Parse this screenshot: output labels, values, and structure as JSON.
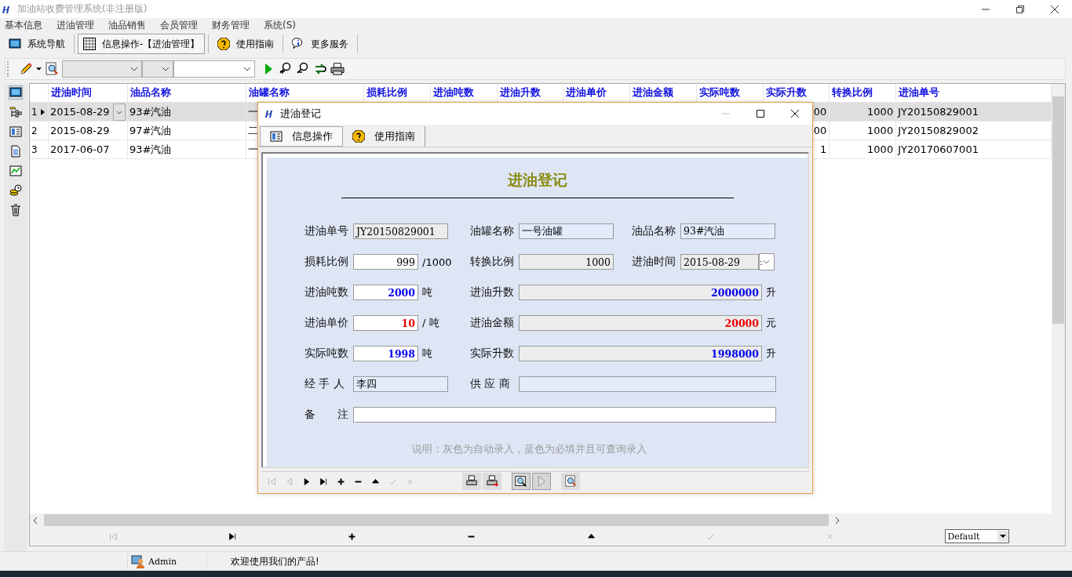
{
  "window": {
    "title": "加油站收费管理系统(非注册版)"
  },
  "menu": [
    "基本信息",
    "进油管理",
    "油品销售",
    "会员管理",
    "财务管理",
    "系统(S)"
  ],
  "toolbar": [
    {
      "label": "系统导航",
      "selected": false
    },
    {
      "label": "信息操作-【进油管理】",
      "selected": true
    },
    {
      "label": "使用指南",
      "selected": false
    },
    {
      "label": "更多服务",
      "selected": false
    }
  ],
  "filter_bar": {
    "combos": [
      {
        "kind": "grey"
      },
      {
        "kind": "grey"
      },
      {
        "kind": "white"
      }
    ]
  },
  "sidebar": {
    "items": [
      {
        "selected": true
      },
      {
        "selected": false
      },
      {
        "selected": false
      },
      {
        "selected": false
      },
      {
        "selected": false
      },
      {
        "selected": false
      },
      {
        "selected": false
      }
    ]
  },
  "table": {
    "columns": [
      {
        "label": "进油时间"
      },
      {
        "label": "油品名称"
      },
      {
        "label": "油罐名称"
      },
      {
        "label": "损耗比例"
      },
      {
        "label": "进油吨数"
      },
      {
        "label": "进油升数"
      },
      {
        "label": "进油单价"
      },
      {
        "label": "进油金额"
      },
      {
        "label": "实际吨数"
      },
      {
        "label": "实际升数"
      },
      {
        "label": "转换比例"
      },
      {
        "label": "进油单号"
      }
    ],
    "rows": [
      {
        "number": "1",
        "selected": true,
        "cells": [
          "2015-08-29",
          "93#汽油",
          "一",
          null,
          null,
          null,
          null,
          null,
          null,
          "00",
          "1000",
          "JY20150829001"
        ]
      },
      {
        "number": "2",
        "selected": false,
        "cells": [
          "2015-08-29",
          "97#汽油",
          "二",
          null,
          null,
          null,
          null,
          null,
          null,
          "00",
          "1000",
          "JY20150829002"
        ]
      },
      {
        "number": "3",
        "selected": false,
        "cells": [
          "2017-06-07",
          "93#汽油",
          "一",
          null,
          null,
          null,
          null,
          null,
          null,
          "1",
          "1000",
          "JY20170607001"
        ]
      }
    ]
  },
  "record_nav": [
    {
      "disabled": true
    },
    {
      "disabled": false
    },
    {
      "disabled": false
    },
    {
      "disabled": false
    },
    {
      "disabled": false
    },
    {
      "disabled": true
    },
    {
      "disabled": true
    }
  ],
  "view_select": {
    "value": "Default"
  },
  "status_bar": {
    "user": "Admin",
    "message": "欢迎使用我们的产品!"
  },
  "dialog": {
    "title": "进油登记",
    "tabs": [
      {
        "label": "信息操作",
        "selected": true
      },
      {
        "label": "使用指南",
        "selected": false
      }
    ],
    "heading": "进油登记",
    "rows": [
      [
        {
          "label": "进油单号",
          "value": "JY20150829001",
          "kind": "medium",
          "auto": true,
          "right_aligned": false
        },
        {
          "label": "油罐名称",
          "value": "一号油罐",
          "kind": "medium",
          "required": true,
          "right_aligned": false
        },
        {
          "label": "油品名称",
          "value": "93#汽油",
          "kind": "medium",
          "required": true,
          "right_aligned": false
        }
      ],
      [
        {
          "label": "损耗比例",
          "value": "999",
          "kind": "short",
          "auto": false,
          "required": false,
          "right_aligned": true,
          "suffix": "/1000"
        },
        {
          "label": "转换比例",
          "value": "1000",
          "kind": "medium",
          "auto": true,
          "right_aligned": true
        },
        {
          "label": "进油时间",
          "value": "2015-08-29",
          "kind": "date",
          "auto": true,
          "right_aligned": false,
          "button_text": ":"
        }
      ],
      [
        {
          "label": "进油吨数",
          "value": "2000",
          "kind": "short",
          "auto": false,
          "required": false,
          "right_aligned": true,
          "color": "#0000ee",
          "suffix": "吨"
        },
        {
          "label": "进油升数",
          "value": "2000000",
          "kind": "wide",
          "auto": true,
          "right_aligned": true,
          "color": "#0000ee",
          "suffix": "升"
        }
      ],
      [
        {
          "label": "进油单价",
          "value": "10",
          "kind": "short",
          "auto": false,
          "required": false,
          "right_aligned": true,
          "color": "#ee0000",
          "suffix": "/ 吨"
        },
        {
          "label": "进油金额",
          "value": "20000",
          "kind": "wide",
          "auto": true,
          "right_aligned": true,
          "color": "#ee0000",
          "suffix": "元"
        }
      ],
      [
        {
          "label": "实际吨数",
          "value": "1998",
          "kind": "short",
          "auto": false,
          "required": false,
          "right_aligned": true,
          "color": "#0000ee",
          "suffix": "吨"
        },
        {
          "label": "实际升数",
          "value": "1998000",
          "kind": "wide",
          "auto": true,
          "right_aligned": true,
          "color": "#0000ee",
          "suffix": "升"
        }
      ],
      [
        {
          "label": "经 手 人",
          "value": "李四",
          "kind": "medium",
          "required": true,
          "right_aligned": false
        },
        {
          "label": "供 应 商",
          "kind": "full",
          "required": true
        }
      ],
      [
        {
          "label": "备　　注",
          "kind": "full",
          "auto": false,
          "required": false
        }
      ]
    ],
    "note": "说明：灰色为自动录入，蓝色为必填并且可查询录入",
    "nav": [
      {
        "disabled": true
      },
      {
        "disabled": true
      },
      {
        "disabled": false
      },
      {
        "disabled": false
      },
      {
        "disabled": false
      },
      {
        "disabled": false
      },
      {
        "disabled": false
      },
      {
        "disabled": true
      },
      {
        "disabled": true
      }
    ],
    "tools": [
      {
        "pressed": false,
        "disabled": false
      },
      {
        "pressed": false,
        "disabled": false
      },
      {
        "pressed": true,
        "disabled": false
      },
      {
        "pressed": true,
        "disabled": true
      },
      {
        "pressed": false,
        "disabled": false
      }
    ]
  }
}
